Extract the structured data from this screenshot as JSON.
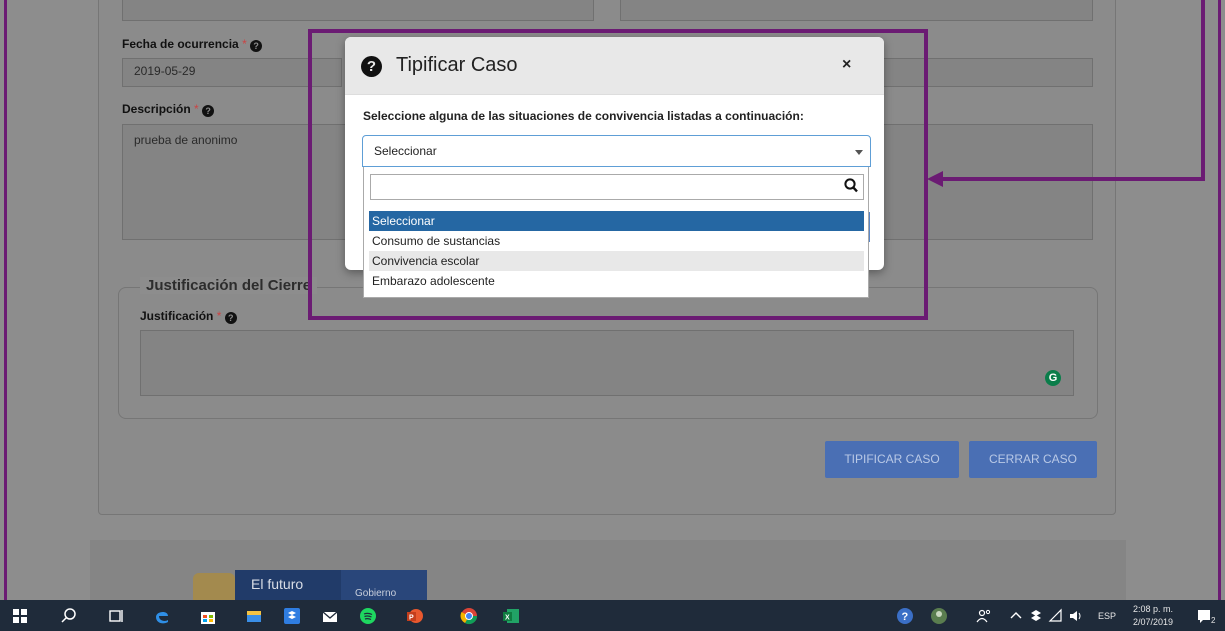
{
  "form": {
    "fecha_label": "Fecha de ocurrencia",
    "fecha_value": "2019-05-29",
    "descripcion_label": "Descripción",
    "descripcion_value": "prueba de anonimo",
    "required_mark": "*",
    "fieldset_legend": "Justificación del Cierre",
    "justificacion_label": "Justificación",
    "grammarly_glyph": "G"
  },
  "buttons": {
    "tipificar": "TIPIFICAR CASO",
    "cerrar": "CERRAR CASO"
  },
  "footer": {
    "logo_text": "El futuro",
    "logo_sub": "Gobierno"
  },
  "modal": {
    "title": "Tipificar Caso",
    "close_glyph": "×",
    "prompt": "Seleccione alguna de las situaciones de convivencia listadas a continuación:",
    "select_value": "Seleccionar",
    "search_placeholder": "",
    "options": [
      "Seleccionar",
      "Consumo de sustancias",
      "Convivencia escolar",
      "Embarazo adolescente"
    ],
    "selected_index": 0,
    "hovered_index": 2
  },
  "annotation": {
    "color": "#6b1b73"
  },
  "taskbar": {
    "language": "ESP",
    "time": "2:08 p. m.",
    "date": "2/07/2019",
    "notification_count": "2",
    "icons": [
      "windows-start-icon",
      "search-icon",
      "task-view-icon",
      "edge-icon",
      "store-icon",
      "file-explorer-icon",
      "dropbox-icon",
      "mail-icon",
      "spotify-icon",
      "powerpoint-icon",
      "chrome-icon",
      "excel-icon"
    ]
  }
}
